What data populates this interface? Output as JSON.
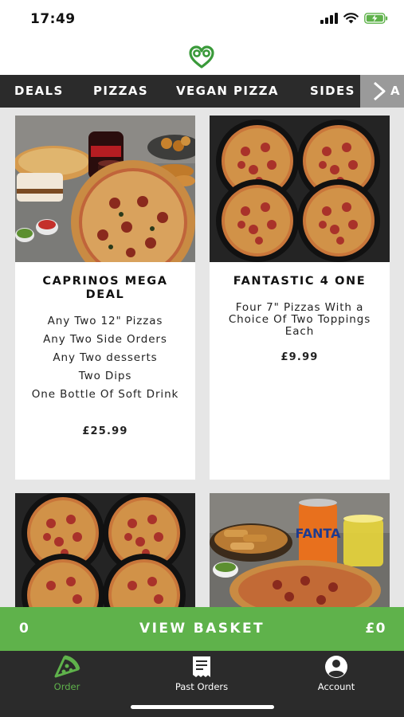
{
  "status": {
    "time": "17:49"
  },
  "brand": {
    "accent": "#5fb24b",
    "dark": "#2b2b2b"
  },
  "categories": [
    {
      "label": "DEALS"
    },
    {
      "label": "PIZZAS"
    },
    {
      "label": "VEGAN PIZZA"
    },
    {
      "label": "SIDES"
    }
  ],
  "category_overflow": "A",
  "products": [
    {
      "title": "CAPRINOS MEGA DEAL",
      "lines": [
        "Any Two 12\" Pizzas",
        "Any Two Side Orders",
        "Any Two desserts",
        "Two Dips",
        "One Bottle Of Soft Drink"
      ],
      "price": "£25.99",
      "image": "meal-deal-spread"
    },
    {
      "title": "FANTASTIC 4 ONE",
      "lines": [
        "Four 7\" Pizzas With a Choice Of Two Toppings Each"
      ],
      "price": "£9.99",
      "image": "four-pepperoni-pizzas"
    },
    {
      "image": "four-pepperoni-pizzas"
    },
    {
      "image": "pizza-sides-fanta"
    }
  ],
  "basket": {
    "count": "0",
    "label": "VIEW BASKET",
    "total": "£0"
  },
  "tabs": [
    {
      "label": "Order",
      "icon": "pizza-slice-icon",
      "active": true
    },
    {
      "label": "Past Orders",
      "icon": "receipt-icon",
      "active": false
    },
    {
      "label": "Account",
      "icon": "account-icon",
      "active": false
    }
  ]
}
